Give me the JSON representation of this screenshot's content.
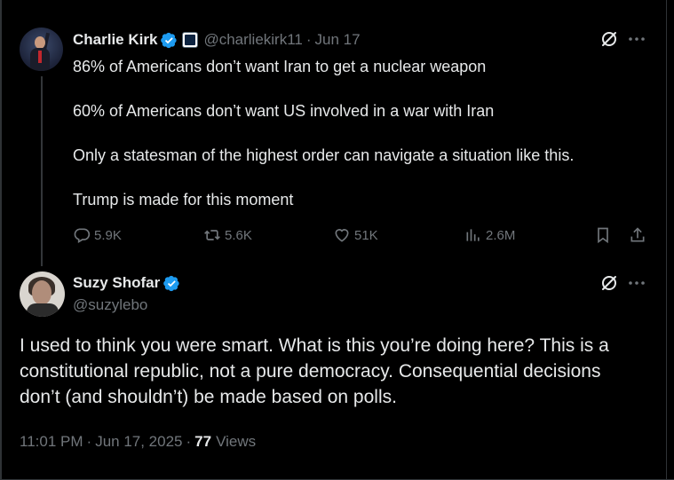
{
  "parent_tweet": {
    "author_name": "Charlie Kirk",
    "handle": "@charliekirk11",
    "separator": "·",
    "date": "Jun 17",
    "paragraphs": [
      "86% of Americans don’t want Iran to get a nuclear weapon",
      "60% of Americans don’t want US involved in a war with Iran",
      "Only a statesman of the highest order can navigate a situation like this.",
      "Trump is made for this moment"
    ],
    "actions": {
      "replies": "5.9K",
      "reposts": "5.6K",
      "likes": "51K",
      "views": "2.6M"
    }
  },
  "reply_tweet": {
    "author_name": "Suzy Shofar",
    "handle": "@suzylebo",
    "text": "I used to think you were smart. What is this you’re doing here? This is a constitutional republic, not a pure democracy. Consequential decisions don’t (and shouldn’t) be made based on polls.",
    "time": "11:01 PM",
    "date": "Jun 17, 2025",
    "separator": "·",
    "views_count": "77",
    "views_label": "Views"
  },
  "icons": {
    "verified": "verified-badge-icon",
    "affiliate": "affiliate-badge-icon",
    "grok": "grok-icon",
    "more": "more-icon",
    "reply": "reply-icon",
    "repost": "repost-icon",
    "like": "like-icon",
    "views": "views-icon",
    "bookmark": "bookmark-icon",
    "share": "share-icon"
  },
  "colors": {
    "background": "#000000",
    "text_primary": "#e7e9ea",
    "text_secondary": "#71767b",
    "verified_blue": "#1d9bf0",
    "border": "#2f3336"
  }
}
